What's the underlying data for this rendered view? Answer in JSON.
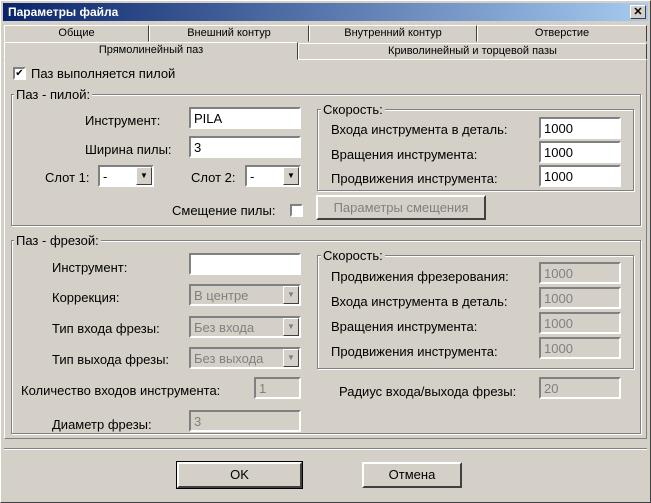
{
  "window": {
    "title": "Параметры файла",
    "close_glyph": "✕"
  },
  "tabs_row1": [
    "Общие",
    "Внешний контур",
    "Внутренний контур",
    "Отверстие"
  ],
  "tabs_row2": [
    "Прямолинейный паз",
    "Криволинейный и торцевой пазы"
  ],
  "saw_checkbox": {
    "label": "Паз выполняется пилой",
    "checked": "✔"
  },
  "saw_group": {
    "title": "Паз - пилой:",
    "tool_label": "Инструмент:",
    "tool_value": "PILA",
    "width_label": "Ширина пилы:",
    "width_value": "3",
    "slot1_label": "Слот 1:",
    "slot1_value": "-",
    "slot2_label": "Слот 2:",
    "slot2_value": "-",
    "offset_label": "Смещение пилы:",
    "offset_button": "Параметры смещения",
    "speed": {
      "title": "Скорость:",
      "entry_label": "Входа инструмента в деталь:",
      "entry_value": "1000",
      "rotation_label": "Вращения инструмента:",
      "rotation_value": "1000",
      "feed_label": "Продвижения инструмента:",
      "feed_value": "1000"
    }
  },
  "mill_group": {
    "title": "Паз - фрезой:",
    "tool_label": "Инструмент:",
    "tool_value": "",
    "correction_label": "Коррекция:",
    "correction_value": "В центре",
    "entry_type_label": "Тип входа фрезы:",
    "entry_type_value": "Без входа",
    "exit_type_label": "Тип выхода фрезы:",
    "exit_type_value": "Без выхода",
    "entries_count_label": "Количество входов инструмента:",
    "entries_count_value": "1",
    "diameter_label": "Диаметр фрезы:",
    "diameter_value": "3",
    "radius_label": "Радиус входа/выхода фрезы:",
    "radius_value": "20",
    "speed": {
      "title": "Скорость:",
      "milling_feed_label": "Продвижения фрезерования:",
      "milling_feed_value": "1000",
      "entry_label": "Входа инструмента в деталь:",
      "entry_value": "1000",
      "rotation_label": "Вращения инструмента:",
      "rotation_value": "1000",
      "feed_label": "Продвижения инструмента:",
      "feed_value": "1000"
    }
  },
  "buttons": {
    "ok": "OK",
    "cancel": "Отмена"
  }
}
